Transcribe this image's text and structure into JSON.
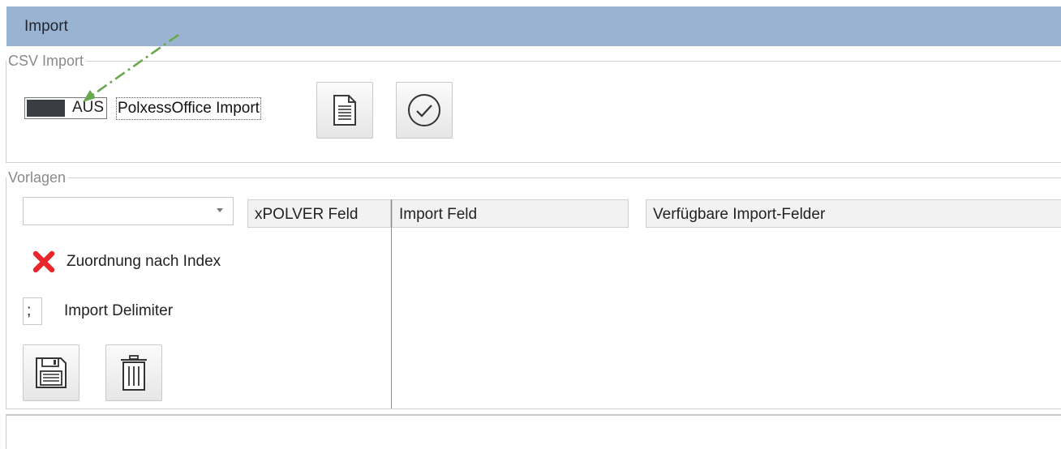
{
  "window": {
    "title": "Import"
  },
  "csv_group": {
    "legend": "CSV Import",
    "toggle": {
      "state_label": "AUS",
      "caption": "PolxessOffice Import"
    },
    "buttons": {
      "file": "document-icon",
      "confirm": "checkmark-circle-icon"
    }
  },
  "vorlagen_group": {
    "legend": "Vorlagen",
    "template_select": {
      "value": ""
    },
    "mapping_by_index": {
      "label": "Zuordnung nach Index",
      "icon": "red-x-icon"
    },
    "delimiter": {
      "value": ";",
      "label": "Import Delimiter"
    },
    "buttons": {
      "save": "floppy-disk-icon",
      "delete": "trash-icon"
    },
    "columns": {
      "xpolver_feld": "xPOLVER Feld",
      "import_feld": "Import Feld",
      "verfuegbare": "Verfügbare Import-Felder"
    }
  },
  "colors": {
    "titlebar": "#9ab3d0",
    "annotation_arrow": "#6aa84f",
    "red_x": "#e8262b"
  }
}
